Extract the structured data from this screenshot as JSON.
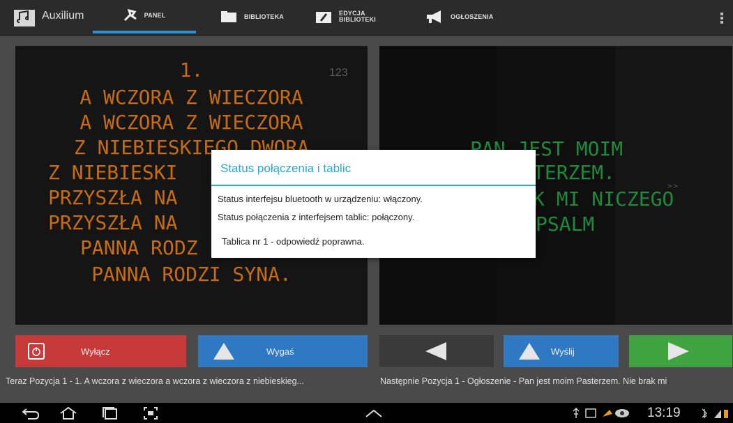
{
  "app": {
    "title": "Auxilium"
  },
  "tabs": [
    {
      "label": "PANEL",
      "active": true,
      "icon": "panel-icon"
    },
    {
      "label": "BIBLIOTEKA",
      "active": false,
      "icon": "folder-icon"
    },
    {
      "label_line1": "EDYCJA",
      "label_line2": "BIBLIOTEKI",
      "active": false,
      "icon": "folder-edit-icon"
    },
    {
      "label": "OGŁOSZENIA",
      "active": false,
      "icon": "megaphone-icon"
    }
  ],
  "left_panel": {
    "counter": "123",
    "number": "1.",
    "lines": [
      "A WCZORA Z WIECZORA",
      "A WCZORA Z WIECZORA",
      "Z NIEBIESKIEGO DWORA",
      "Z NIEBIESKI",
      "PRZYSZŁA NA",
      "PRZYSZŁA NA",
      "PANNA RODZ",
      "PANNA RODZI SYNA."
    ],
    "text_color": "#c76c12"
  },
  "right_panel": {
    "lines": [
      "PAN JEST MOIM",
      "TERZEM.",
      "K MI NICZEGO",
      "PSALM"
    ],
    "arrows": ">>",
    "text_color": "#1f8a3b"
  },
  "buttons": {
    "off": "Wyłącz",
    "dim": "Wygaś",
    "send": "Wyślij"
  },
  "status": {
    "now": "Teraz  Pozycja 1 - 1. A wczora z wieczora a wczora z wieczora z niebieskieg...",
    "next": "Następnie  Pozycja 1 - Ogłoszenie - Pan jest moim Pasterzem. Nie brak mi"
  },
  "system": {
    "clock": "13:19"
  },
  "dialog": {
    "title": "Status połączenia i tablic",
    "line1": "Status interfejsu bluetooth w urządzeniu:  włączony.",
    "line2": "Status połączenia z interfejsem tablic:  połączony.",
    "line3": "Tablica nr 1 - odpowiedź poprawna."
  },
  "colors": {
    "accent": "#2aa8d6",
    "red": "#c73a3a",
    "blue": "#2f78c2",
    "green": "#3fa33f"
  }
}
